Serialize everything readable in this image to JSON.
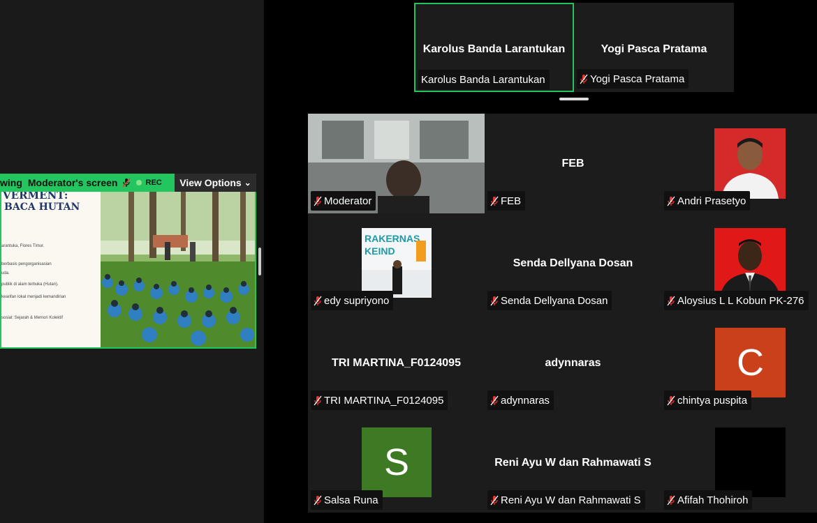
{
  "share_bar": {
    "viewing_label": "wing",
    "sharer_label": "Moderator's screen",
    "rec_label": "REC",
    "view_options_label": "View Options",
    "accent_color": "#22c55e"
  },
  "shared_slide": {
    "title_line1": "VERMENT:",
    "title_line2": "BACA HUTAN",
    "lines": [
      "arantuka, Flores Timur.",
      "berbasis pengorganisasian",
      "uda.",
      "publik di alam terbuka (Hutan).",
      "kearifan lokal menjadi kemandirian",
      "sosial: Sejarah & Memori Kolektif"
    ]
  },
  "top_speakers": [
    {
      "display_name": "Karolus Banda Larantukan",
      "tag": "Karolus Banda Larantukan",
      "muted": false,
      "active": true
    },
    {
      "display_name": "Yogi Pasca Pratama",
      "tag": "Yogi Pasca Pratama",
      "muted": true,
      "active": false
    }
  ],
  "participants": [
    {
      "tag": "Moderator",
      "kind": "video"
    },
    {
      "tag": "FEB",
      "center_name": "FEB",
      "kind": "name"
    },
    {
      "tag": "Andri Prasetyo",
      "kind": "photo"
    },
    {
      "tag": "edy supriyono",
      "kind": "photo-banner"
    },
    {
      "tag": "Senda Dellyana Dosan",
      "center_name": "Senda Dellyana Dosan",
      "kind": "name"
    },
    {
      "tag": "Aloysius L L Kobun PK-276",
      "kind": "photo"
    },
    {
      "tag": "TRI MARTINA_F0124095",
      "center_name": "TRI MARTINA_F0124095",
      "kind": "name"
    },
    {
      "tag": "adynnaras",
      "center_name": "adynnaras",
      "kind": "name"
    },
    {
      "tag": "chintya puspita",
      "initial": "C",
      "kind": "initial",
      "color": "#c9401a"
    },
    {
      "tag": "Salsa Runa",
      "initial": "S",
      "kind": "initial",
      "color": "#3d7a23"
    },
    {
      "tag": "Reni Ayu W dan Rahmawati S",
      "center_name": "Reni Ayu W dan Rahmawati S",
      "kind": "name"
    },
    {
      "tag": "Afifah Thohiroh",
      "kind": "black"
    }
  ]
}
